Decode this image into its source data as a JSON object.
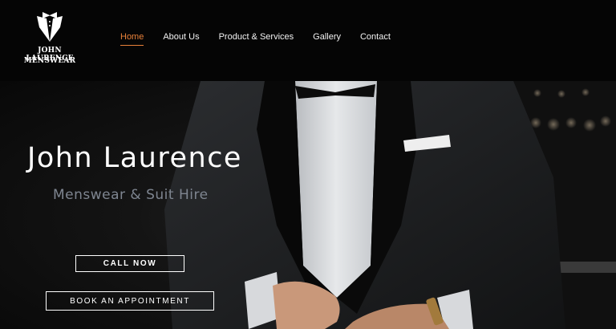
{
  "brand": {
    "line1": "JOHN LAURENCE",
    "line2": "MENSWEAR",
    "icon": "tuxedo-icon"
  },
  "nav": {
    "items": [
      {
        "label": "Home",
        "active": true
      },
      {
        "label": "About Us",
        "active": false
      },
      {
        "label": "Product & Services",
        "active": false
      },
      {
        "label": "Gallery",
        "active": false
      },
      {
        "label": "Contact",
        "active": false
      }
    ],
    "active_color": "#e8813a"
  },
  "hero": {
    "title": "John Laurence",
    "subtitle": "Menswear & Suit Hire",
    "call_button": "CALL NOW",
    "book_button": "BOOK AN APPOINTMENT"
  },
  "colors": {
    "header_bg": "#050505",
    "accent": "#e8813a",
    "subtitle": "#7e8590"
  }
}
